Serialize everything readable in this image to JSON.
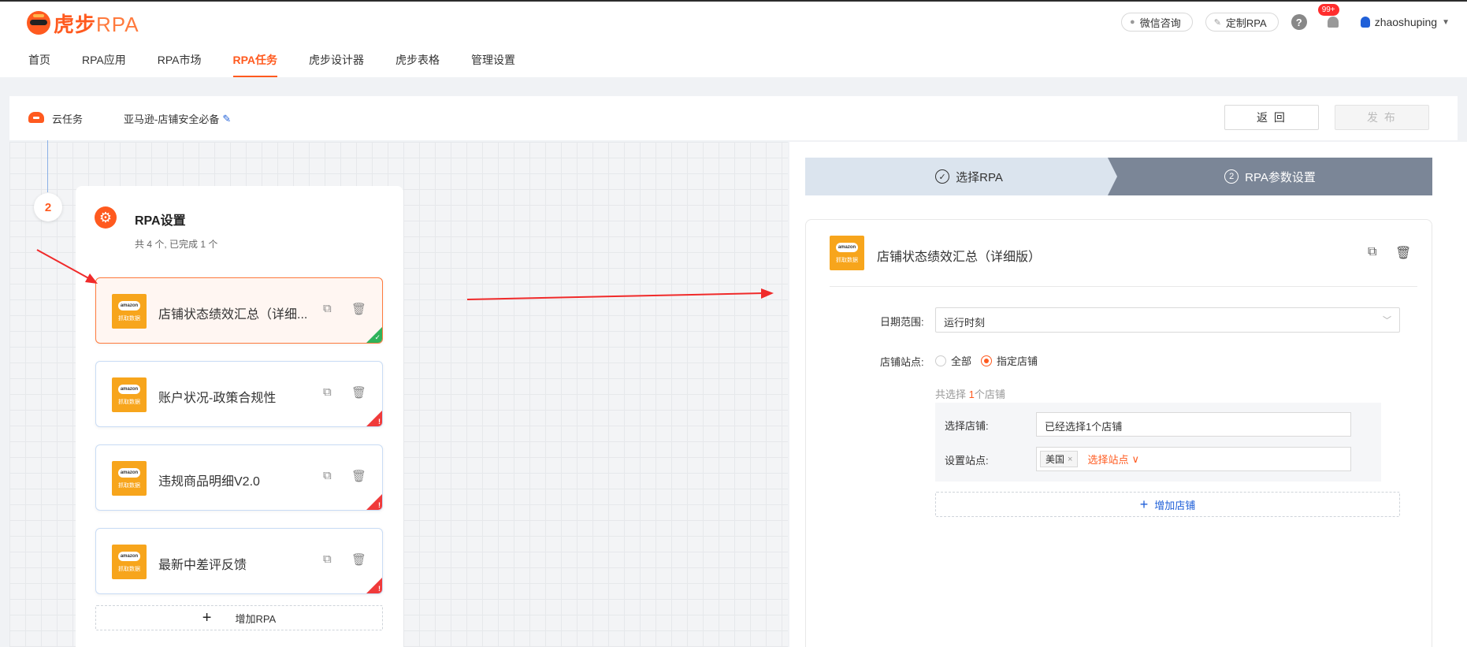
{
  "header": {
    "logo_text": "虎步",
    "logo_rpa": "RPA",
    "nav": [
      {
        "label": "首页"
      },
      {
        "label": "RPA应用"
      },
      {
        "label": "RPA市场"
      },
      {
        "label": "RPA任务",
        "active": true
      },
      {
        "label": "虎步设计器"
      },
      {
        "label": "虎步表格"
      },
      {
        "label": "管理设置"
      }
    ],
    "wechat_label": "微信咨询",
    "custom_rpa_label": "定制RPA",
    "help_label": "?",
    "notification_badge": "99+",
    "username": "zhaoshuping"
  },
  "subheader": {
    "type_label": "云任务",
    "task_name": "亚马逊-店铺安全必备",
    "back_label": "返 回",
    "publish_label": "发 布"
  },
  "canvas": {
    "step_number": "2",
    "panel_title": "RPA设置",
    "panel_subtitle": "共 4 个, 已完成 1 个",
    "amazon_logo_text": "amazon",
    "amazon_caption": "抓取数据",
    "cards": [
      {
        "label": "店铺状态绩效汇总（详细...",
        "status": "ok"
      },
      {
        "label": "账户状况-政策合规性",
        "status": "error"
      },
      {
        "label": "违规商品明细V2.0",
        "status": "error"
      },
      {
        "label": "最新中差评反馈",
        "status": "error"
      }
    ],
    "add_rpa_label": "增加RPA"
  },
  "steps": {
    "step1_label": "选择RPA",
    "step2_num": "2",
    "step2_label": "RPA参数设置"
  },
  "form": {
    "title": "店铺状态绩效汇总（详细版）",
    "date_range_label": "日期范围:",
    "date_range_value": "运行时刻",
    "store_site_label": "店铺站点:",
    "radio_all": "全部",
    "radio_specified": "指定店铺",
    "summary_prefix": "共选择 ",
    "summary_count": "1",
    "summary_suffix": "个店铺",
    "select_store_label": "选择店铺:",
    "select_store_value": "已经选择1个店铺",
    "set_site_label": "设置站点:",
    "site_tag": "美国",
    "pick_site_label": "选择站点",
    "add_store_label": "增加店铺"
  },
  "colors": {
    "accent": "#ff5a1f",
    "success": "#2fb25a",
    "error": "#f03a3a",
    "link": "#2060d8",
    "step_active_bg": "#7b8697"
  }
}
